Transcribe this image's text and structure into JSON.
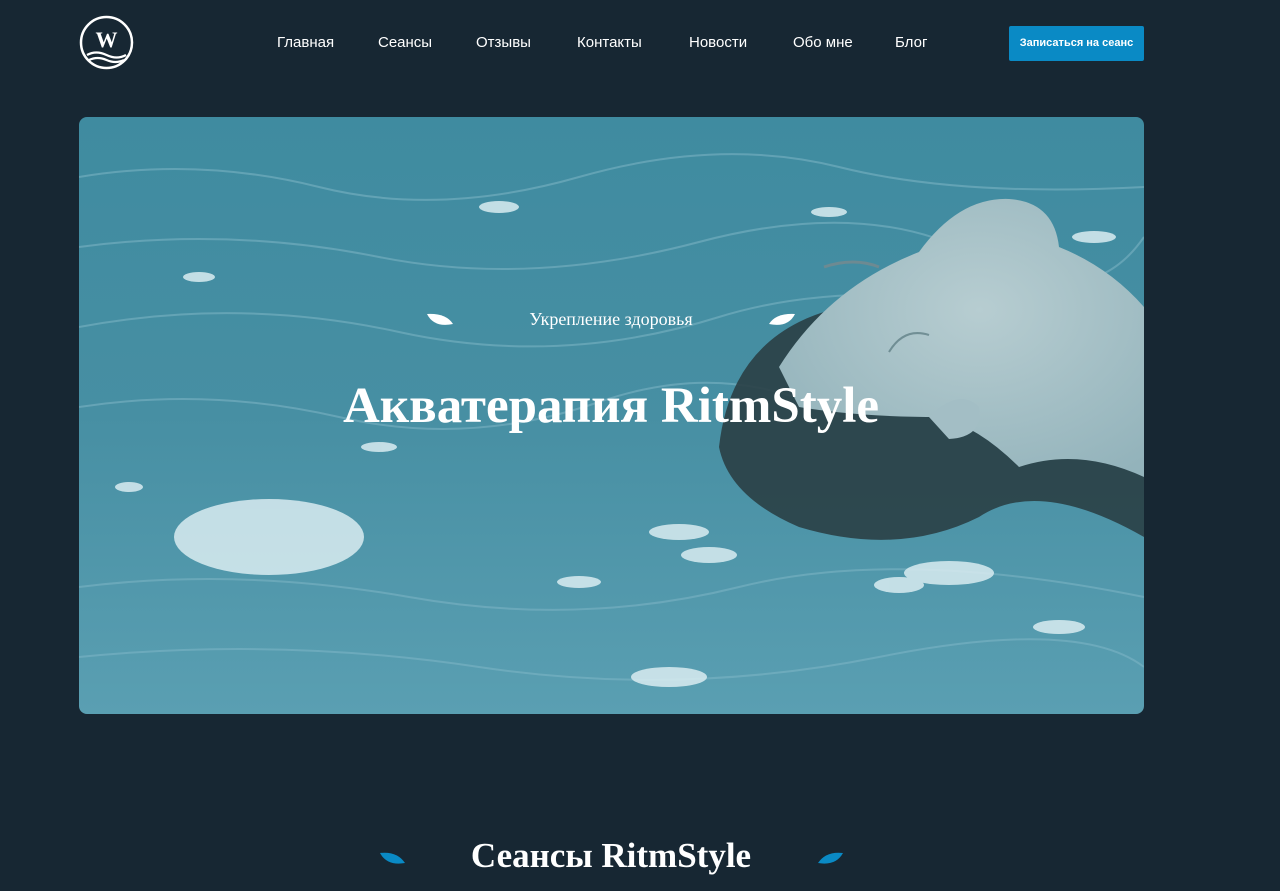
{
  "brand": {
    "logo_icon": "w-wave-logo-icon",
    "logo_letter": "W"
  },
  "nav": {
    "items": [
      {
        "label": "Главная"
      },
      {
        "label": "Сеансы"
      },
      {
        "label": "Отзывы"
      },
      {
        "label": "Контакты"
      },
      {
        "label": "Новости"
      },
      {
        "label": "Обо мне"
      },
      {
        "label": "Блог"
      }
    ]
  },
  "header": {
    "cta_label": "Записаться на сеанс"
  },
  "hero": {
    "kicker": "Укрепление здоровья",
    "title": "Акватерапия RitmStyle",
    "image": "woman-floating-in-water-image",
    "leaf_icon": "leaf-icon"
  },
  "section": {
    "title": "Сеансы RitmStyle",
    "leaf_icon": "leaf-icon"
  },
  "colors": {
    "background": "#172733",
    "accent": "#0a8ac5",
    "text": "#ffffff",
    "hero_tint": "#4a98ad"
  }
}
